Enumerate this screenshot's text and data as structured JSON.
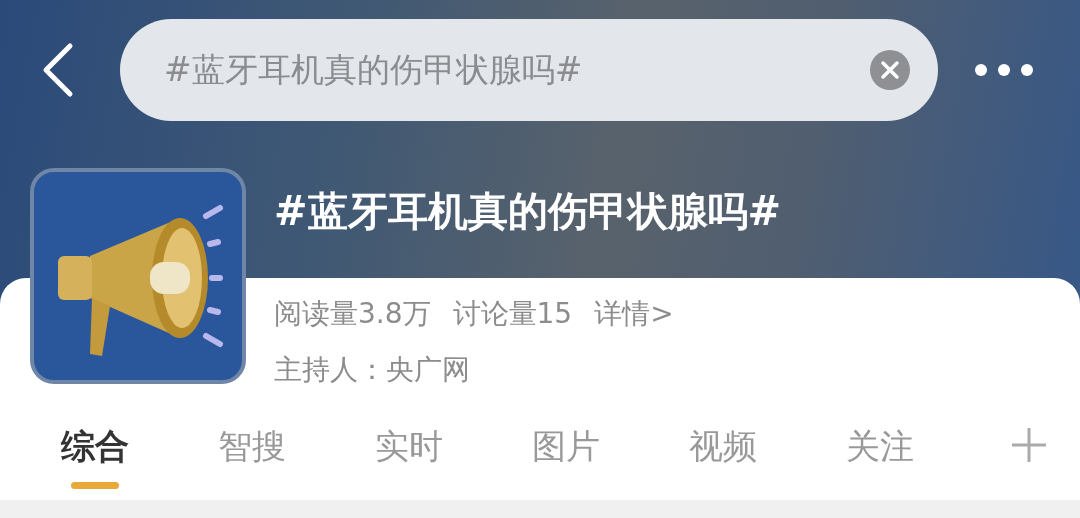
{
  "search": {
    "value": "#蓝牙耳机真的伤甲状腺吗#"
  },
  "topic": {
    "title": "#蓝牙耳机真的伤甲状腺吗#",
    "reads": "阅读量3.8万",
    "discussions": "讨论量15",
    "details_link": "详情>",
    "host": "主持人：央广网"
  },
  "tabs": [
    {
      "label": "综合",
      "selected": true
    },
    {
      "label": "智搜",
      "selected": false
    },
    {
      "label": "实时",
      "selected": false
    },
    {
      "label": "图片",
      "selected": false
    },
    {
      "label": "视频",
      "selected": false
    },
    {
      "label": "关注",
      "selected": false
    }
  ]
}
